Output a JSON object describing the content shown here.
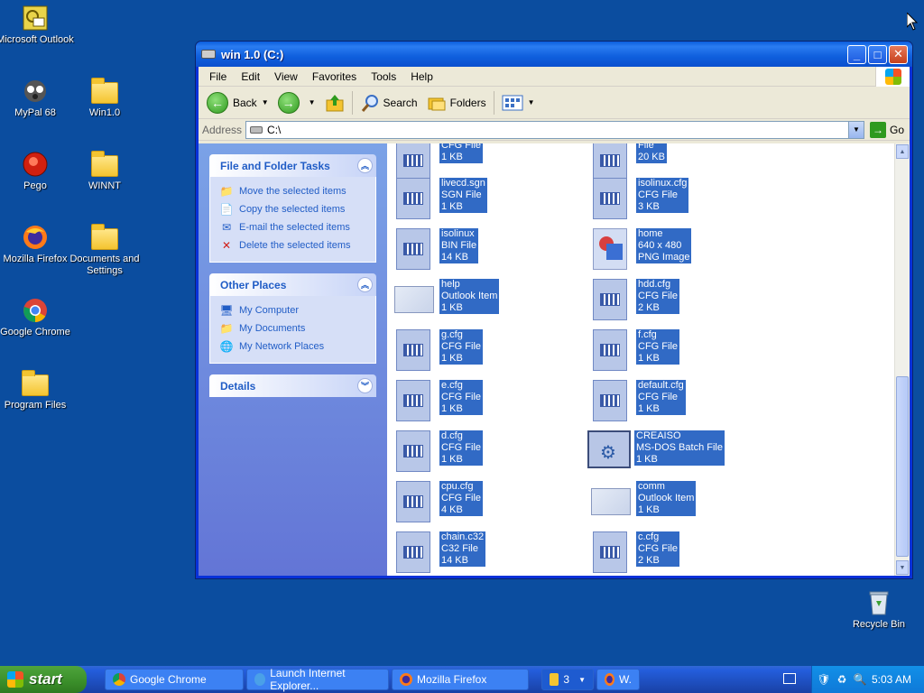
{
  "desktop": {
    "icons": [
      {
        "label": "Microsoft Outlook"
      },
      {
        "label": "MyPal 68"
      },
      {
        "label": "Win1.0"
      },
      {
        "label": "Pego"
      },
      {
        "label": "WINNT"
      },
      {
        "label": "Mozilla Firefox"
      },
      {
        "label": "Documents and Settings"
      },
      {
        "label": "Google Chrome"
      },
      {
        "label": "Program Files"
      },
      {
        "label": "Recycle Bin"
      }
    ]
  },
  "window": {
    "title": "win 1.0 (C:)",
    "menu": [
      "File",
      "Edit",
      "View",
      "Favorites",
      "Tools",
      "Help"
    ],
    "toolbar": {
      "back": "Back",
      "search": "Search",
      "folders": "Folders"
    },
    "address": {
      "label": "Address",
      "value": "C:\\",
      "go": "Go"
    },
    "tasks": {
      "file_folder": {
        "title": "File and Folder Tasks",
        "items": [
          "Move the selected items",
          "Copy the selected items",
          "E-mail the selected items",
          "Delete the selected items"
        ]
      },
      "other_places": {
        "title": "Other Places",
        "items": [
          "My Computer",
          "My Documents",
          "My Network Places"
        ]
      },
      "details": {
        "title": "Details"
      }
    },
    "files": [
      {
        "name": "",
        "type": "CFG File",
        "size": "1 KB"
      },
      {
        "name": "",
        "type": "File",
        "size": "20 KB"
      },
      {
        "name": "livecd.sgn",
        "type": "SGN File",
        "size": "1 KB"
      },
      {
        "name": "isolinux.cfg",
        "type": "CFG File",
        "size": "3 KB"
      },
      {
        "name": "isolinux",
        "type": "BIN File",
        "size": "14 KB"
      },
      {
        "name": "home",
        "type": "640 x 480",
        "size": "PNG Image"
      },
      {
        "name": "help",
        "type": "Outlook Item",
        "size": "1 KB"
      },
      {
        "name": "hdd.cfg",
        "type": "CFG File",
        "size": "2 KB"
      },
      {
        "name": "g.cfg",
        "type": "CFG File",
        "size": "1 KB"
      },
      {
        "name": "f.cfg",
        "type": "CFG File",
        "size": "1 KB"
      },
      {
        "name": "e.cfg",
        "type": "CFG File",
        "size": "1 KB"
      },
      {
        "name": "default.cfg",
        "type": "CFG File",
        "size": "1 KB"
      },
      {
        "name": "d.cfg",
        "type": "CFG File",
        "size": "1 KB"
      },
      {
        "name": "CREAISO",
        "type": "MS-DOS Batch File",
        "size": "1 KB"
      },
      {
        "name": "cpu.cfg",
        "type": "CFG File",
        "size": "4 KB"
      },
      {
        "name": "comm",
        "type": "Outlook Item",
        "size": "1 KB"
      },
      {
        "name": "chain.c32",
        "type": "C32 File",
        "size": "14 KB"
      },
      {
        "name": "c.cfg",
        "type": "CFG File",
        "size": "2 KB"
      }
    ]
  },
  "taskbar": {
    "start": "start",
    "tasks": [
      "Google Chrome",
      "Launch Internet Explorer...",
      "Mozilla Firefox",
      "3",
      "W."
    ],
    "clock": "5:03 AM"
  },
  "colors": {
    "desktop": "#0b4d9f",
    "selection": "#316ac5",
    "taskpane_link": "#215dc6"
  }
}
